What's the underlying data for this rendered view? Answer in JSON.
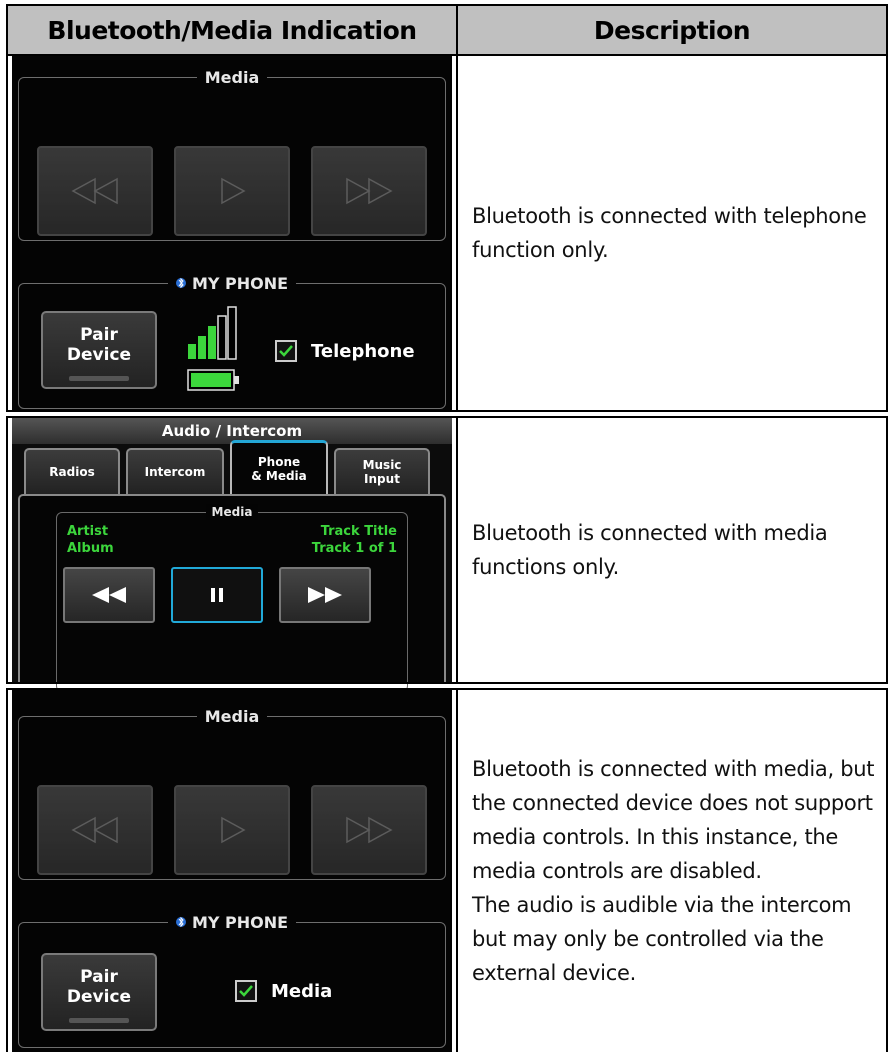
{
  "table": {
    "headers": [
      "Bluetooth/Media Indication",
      "Description"
    ],
    "rows": [
      {
        "description": [
          "Bluetooth is connected with telephone function only."
        ]
      },
      {
        "description": [
          "Bluetooth is connected with media functions only."
        ]
      },
      {
        "description": [
          "Bluetooth is connected with media, but the connected device does not support media controls.  In this instance, the media controls are disabled.",
          "The audio is audible via the intercom but may only be controlled via the external device."
        ]
      }
    ]
  },
  "screen1": {
    "media_title": "Media",
    "phone_title": "MY PHONE",
    "pair_label_1": "Pair",
    "pair_label_2": "Device",
    "checkbox_label": "Telephone",
    "checkbox_checked": true,
    "signal_bars_active": 3,
    "signal_bars_total": 5,
    "battery_level": 0.9,
    "media_buttons_enabled": false
  },
  "screen2": {
    "title": "Audio / Intercom",
    "tabs": [
      {
        "label_1": "Radios",
        "label_2": ""
      },
      {
        "label_1": "Intercom",
        "label_2": ""
      },
      {
        "label_1": "Phone",
        "label_2": "& Media"
      },
      {
        "label_1": "Music",
        "label_2": "Input"
      }
    ],
    "active_tab": "Phone & Media",
    "media_title": "Media",
    "artist": "Artist",
    "album": "Album",
    "track_title": "Track Title",
    "track_count": "Track 1 of 1",
    "playing": true
  },
  "screen3": {
    "media_title": "Media",
    "phone_title": "MY PHONE",
    "pair_label_1": "Pair",
    "pair_label_2": "Device",
    "checkbox_label": "Media",
    "checkbox_checked": true,
    "media_buttons_enabled": false
  },
  "colors": {
    "header_bg": "#c0c0c0",
    "screen_bg": "#040404",
    "status_green": "#3cd63c",
    "selection_blue": "#21a9d8"
  }
}
